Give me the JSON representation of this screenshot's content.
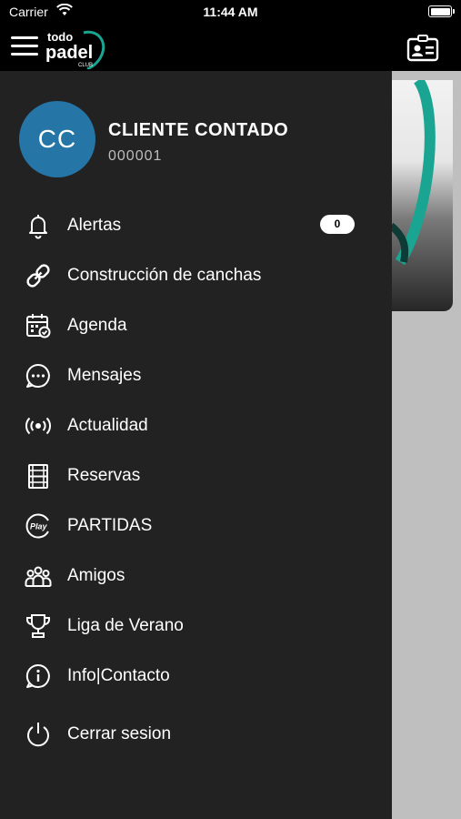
{
  "status_bar": {
    "carrier": "Carrier",
    "time": "11:44 AM"
  },
  "header": {
    "logo_text": "todo padel CLUB"
  },
  "profile": {
    "initials": "CC",
    "name": "CLIENTE CONTADO",
    "code": "000001"
  },
  "menu": [
    {
      "label": "Alertas",
      "icon": "bell-icon",
      "badge": "0"
    },
    {
      "label": "Construcción de canchas",
      "icon": "link-icon"
    },
    {
      "label": "Agenda",
      "icon": "calendar-check-icon"
    },
    {
      "label": "Mensajes",
      "icon": "chat-bubble-icon"
    },
    {
      "label": "Actualidad",
      "icon": "broadcast-icon"
    },
    {
      "label": "Reservas",
      "icon": "court-icon"
    },
    {
      "label": "PARTIDAS",
      "icon": "play-icon"
    },
    {
      "label": "Amigos",
      "icon": "group-icon"
    },
    {
      "label": "Liga de Verano",
      "icon": "trophy-icon"
    },
    {
      "label": "Info|Contacto",
      "icon": "info-icon"
    },
    {
      "label": "Cerrar sesion",
      "icon": "power-icon"
    }
  ],
  "colors": {
    "drawer": "#222222",
    "avatar": "#2575a6",
    "accent": "#1aa592"
  }
}
